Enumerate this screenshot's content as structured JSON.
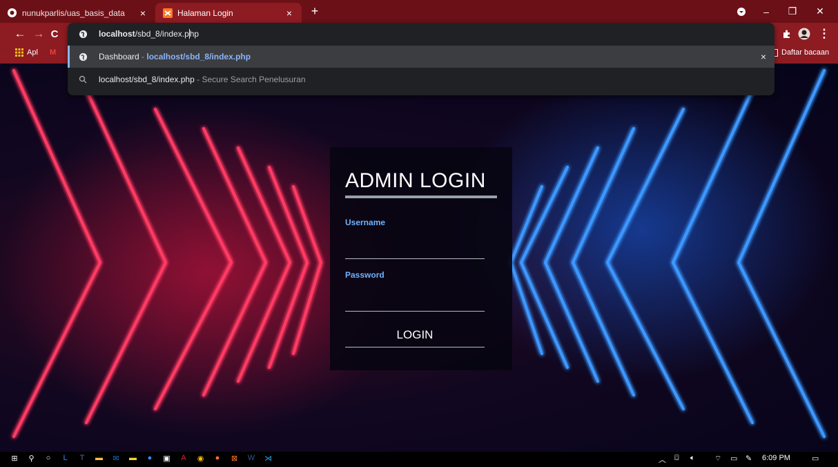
{
  "browser": {
    "tabs": [
      {
        "title": "nunukparlis/uas_basis_data",
        "active": false
      },
      {
        "title": "Halaman Login",
        "active": true
      }
    ],
    "new_tab": "+",
    "close": "×",
    "window": {
      "minimize": "–",
      "restore": "❐",
      "close": "✕"
    },
    "omnibox": {
      "typed_prefix": "localhost",
      "typed_rest": "/sbd_8/index.p",
      "typed_tail": "hp",
      "suggestions": [
        {
          "title": "Dashboard",
          "separator": " - ",
          "url": "localhost/sbd_8/index.php",
          "icon": "globe-icon"
        },
        {
          "title": "localhost/sbd_8/index.php",
          "separator": " - ",
          "url": "Secure Search Penelusuran",
          "icon": "search-icon"
        }
      ],
      "remove": "×"
    },
    "bookmarks": {
      "apps": "Apl",
      "reading_list": "Daftar bacaan"
    }
  },
  "login": {
    "title": "ADMIN LOGIN",
    "username_label": "Username",
    "password_label": "Password",
    "username_value": "",
    "password_value": "",
    "submit": "LOGIN"
  },
  "taskbar": {
    "clock": "6:09 PM",
    "apps": [
      "start",
      "search",
      "cortana",
      "lens",
      "teams",
      "explorer",
      "mail",
      "sticky-notes",
      "zoom",
      "store",
      "acrobat",
      "chrome",
      "firefox",
      "xampp",
      "word",
      "vscode"
    ]
  },
  "colors": {
    "tab_bar": "#6b1016",
    "toolbar": "#8d1b22",
    "omnibox_bg": "#202124",
    "label_blue": "#6fb3ff",
    "neon_red": "#ff2a55",
    "neon_blue": "#2a8cff"
  }
}
